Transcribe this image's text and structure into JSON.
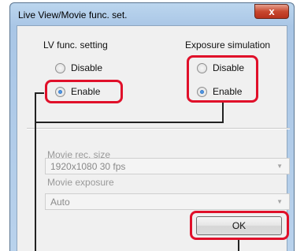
{
  "window": {
    "title": "Live View/Movie func. set.",
    "close_glyph": "x"
  },
  "lv_func": {
    "title": "LV func. setting",
    "options": [
      {
        "label": "Disable",
        "selected": false
      },
      {
        "label": "Enable",
        "selected": true
      }
    ]
  },
  "exposure_sim": {
    "title": "Exposure simulation",
    "options": [
      {
        "label": "Disable",
        "selected": false
      },
      {
        "label": "Enable",
        "selected": true
      }
    ]
  },
  "movie_rec_size": {
    "label": "Movie rec. size",
    "value": "1920x1080  30 fps"
  },
  "movie_exposure": {
    "label": "Movie exposure",
    "value": "Auto"
  },
  "ok_label": "OK",
  "colors": {
    "highlight": "#e0102a",
    "connector": "#222222"
  }
}
